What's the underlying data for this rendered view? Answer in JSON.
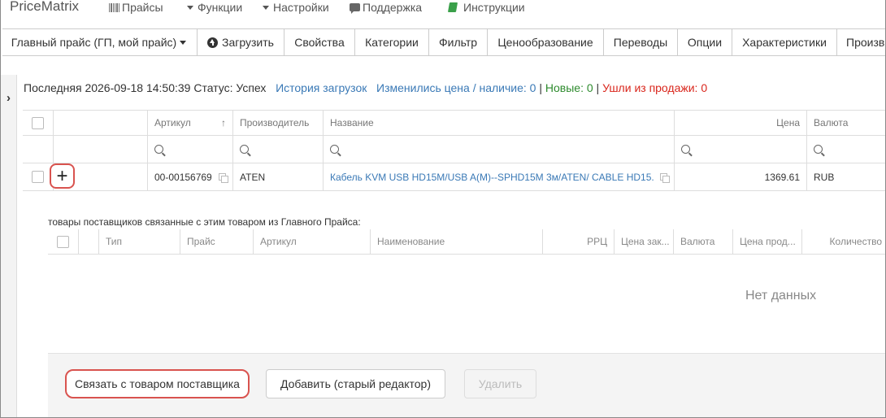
{
  "app": {
    "brand": "PriceMatrix"
  },
  "topnav": {
    "items": [
      {
        "label": "Прайсы",
        "icon": "barcode-icon"
      },
      {
        "label": "Функции",
        "icon": "caret-down-icon"
      },
      {
        "label": "Настройки",
        "icon": "caret-down-icon"
      },
      {
        "label": "Поддержка",
        "icon": "chat-bubble-icon"
      },
      {
        "label": "Инструкции",
        "icon": "book-icon"
      }
    ]
  },
  "tabs": [
    {
      "label": "Главный прайс (ГП, мой прайс)"
    },
    {
      "label": "Загрузить"
    },
    {
      "label": "Свойства"
    },
    {
      "label": "Категории"
    },
    {
      "label": "Фильтр"
    },
    {
      "label": "Ценообразование"
    },
    {
      "label": "Переводы"
    },
    {
      "label": "Опции"
    },
    {
      "label": "Характеристики"
    },
    {
      "label": "Произв"
    }
  ],
  "status": {
    "last": "Последняя 2026-09-18 14:50:39 Статус: Успех",
    "history_link": "История загрузок",
    "changed": "Изменились цена / наличие: 0",
    "sep1": "|",
    "new": "Новые: 0",
    "sep2": "|",
    "gone": "Ушли из продажи: 0"
  },
  "grid": {
    "headers": {
      "article": "Артикул",
      "sort_arrow": "↑",
      "manufacturer": "Производитель",
      "name": "Название",
      "price": "Цена",
      "currency": "Валюта"
    },
    "row": {
      "article": "00-00156769",
      "manufacturer": "ATEN",
      "name": "Кабель KVM USB HD15M/USB A(M)--SPHD15M 3м/ATEN/ CABLE HD15...",
      "price": "1369.61",
      "currency": "RUB",
      "expand": "+"
    }
  },
  "detail": {
    "caption": "товары поставщиков связанные с этим товаром из Главного Прайса:",
    "headers": [
      "Тип",
      "Прайс",
      "Артикул",
      "Наименование",
      "РРЦ",
      "Цена зак...",
      "Валюта",
      "Цена прод...",
      "Количество"
    ],
    "empty": "Нет данных",
    "buttons": {
      "link": "Связать с товаром поставщика",
      "add": "Добавить (старый редактор)",
      "delete": "Удалить"
    }
  },
  "colors": {
    "link": "#3a79b6",
    "green": "#2e8b2e",
    "red": "#d9261c",
    "highlight": "#d9534f"
  }
}
